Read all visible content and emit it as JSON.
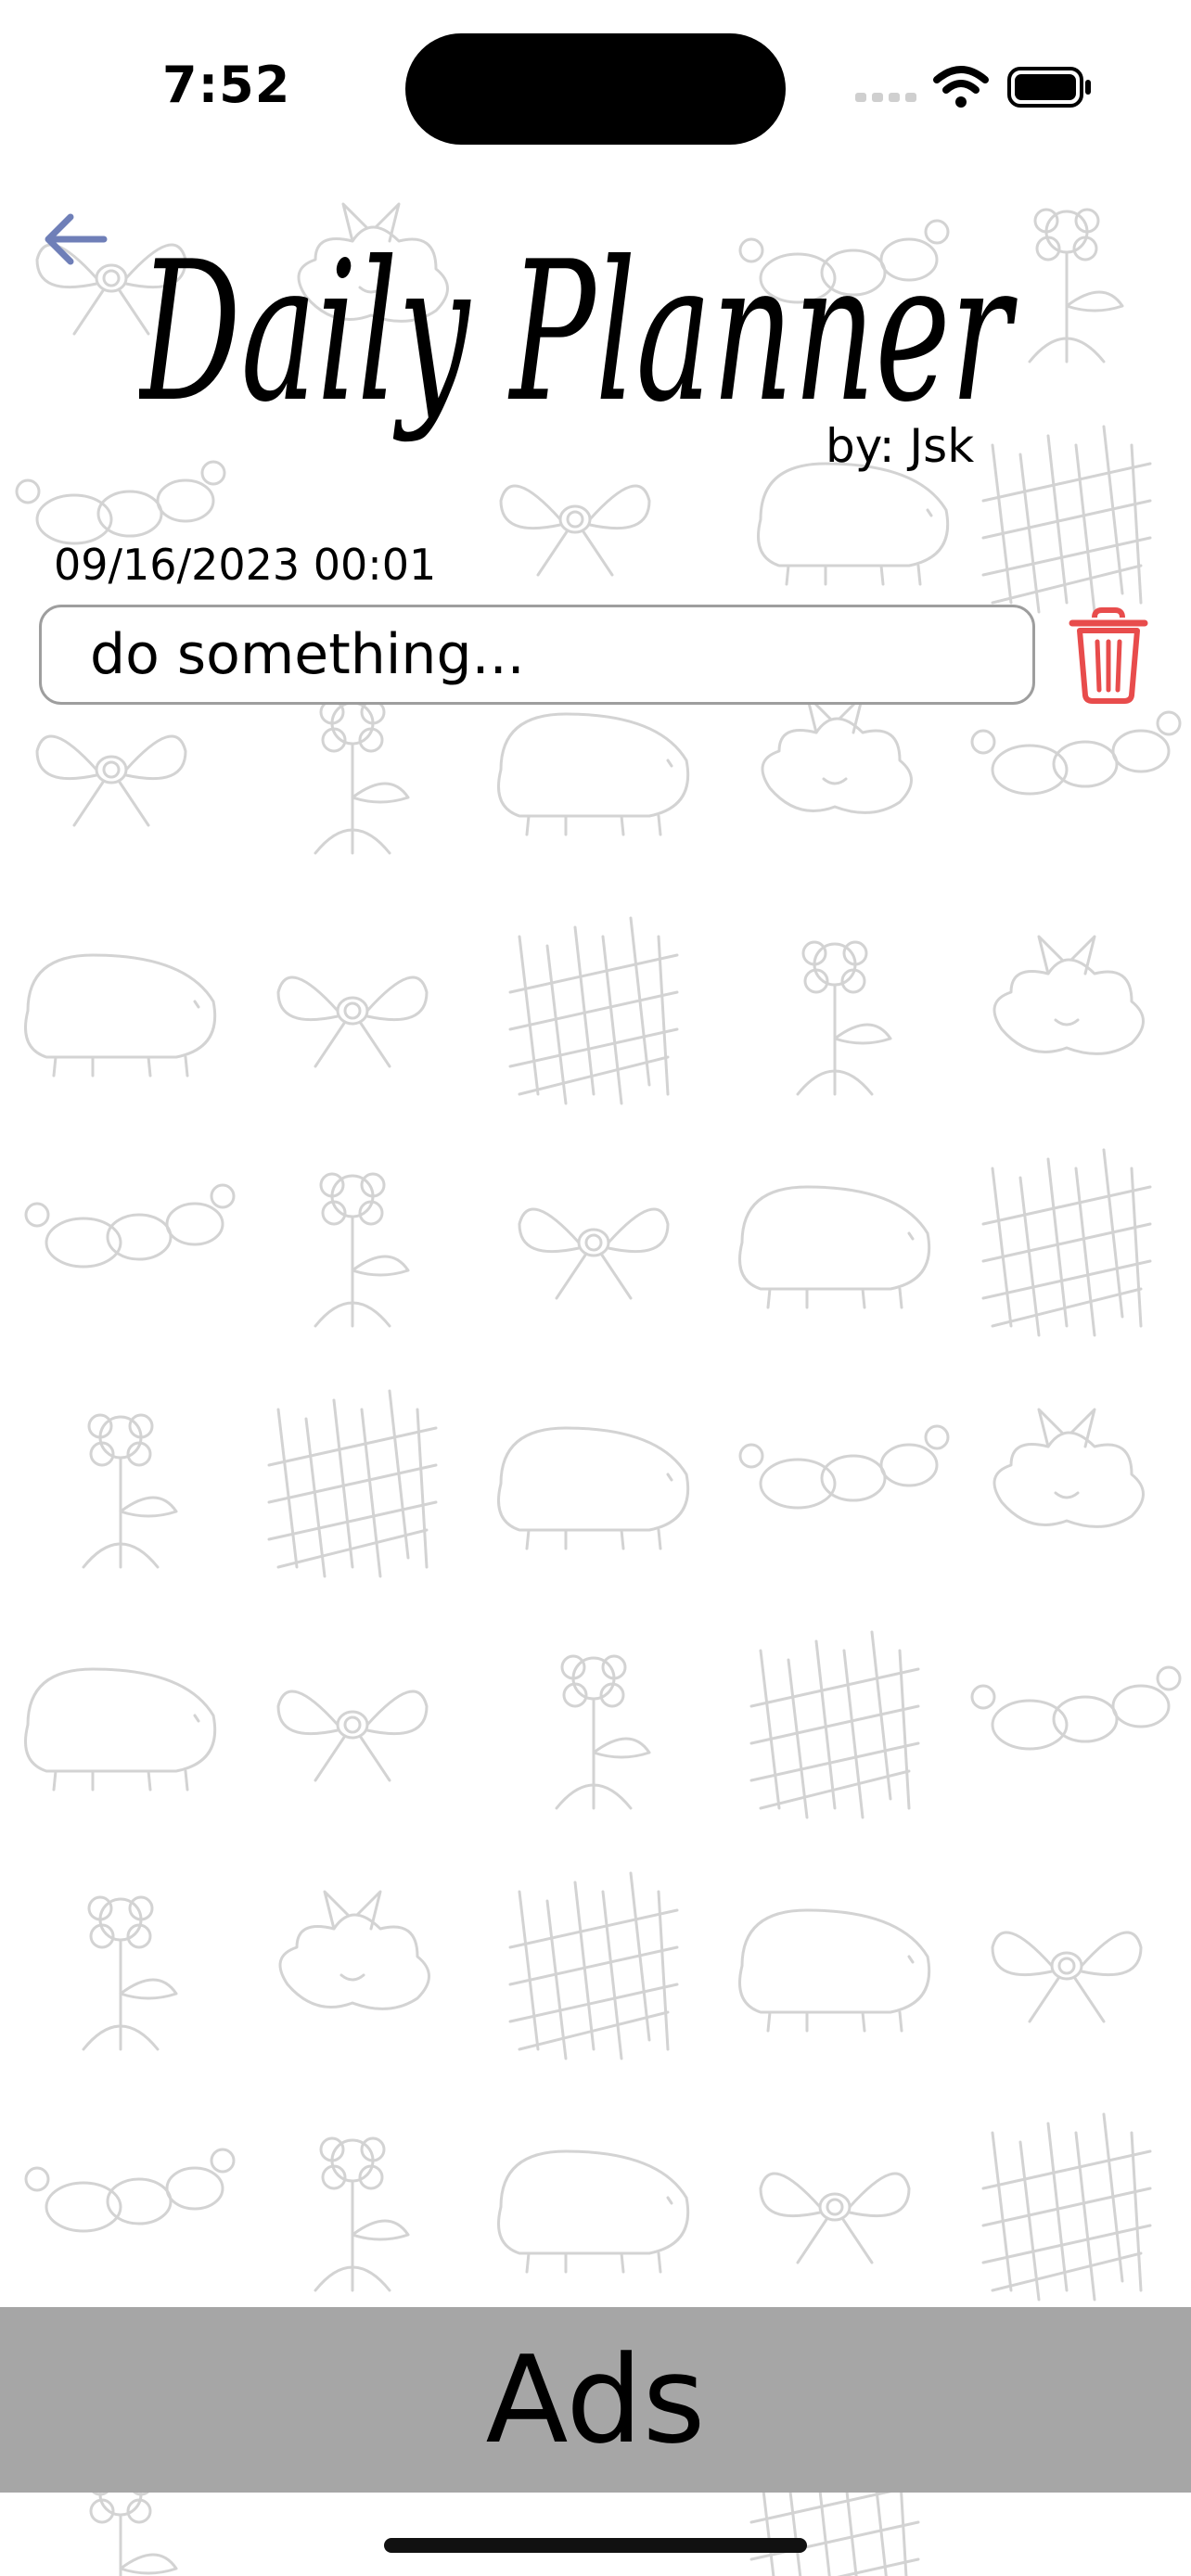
{
  "status_bar": {
    "time": "7:52"
  },
  "header": {
    "title": "Daily Planner",
    "subtitle": "by: Jsk",
    "back_icon": "arrow-left-icon"
  },
  "entry": {
    "date": "09/16/2023 00:01",
    "text": "do something...",
    "delete_icon": "trash-icon"
  },
  "ads": {
    "label": "Ads"
  },
  "colors": {
    "accent_back": "#6f7fb8",
    "delete_red": "#e84c4c",
    "ads_bg": "#a6a6a6",
    "doodle": "#d3d3d3"
  }
}
